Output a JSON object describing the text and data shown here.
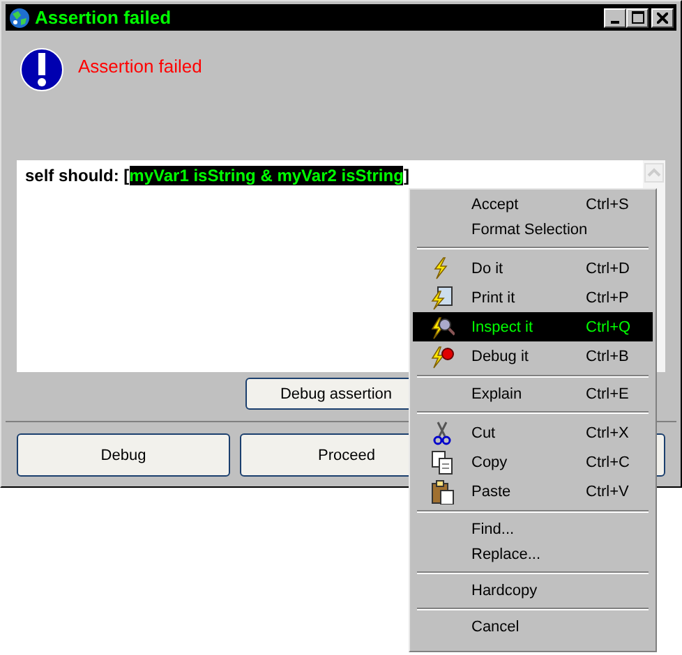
{
  "window": {
    "title": "Assertion failed"
  },
  "message": "Assertion failed",
  "editor": {
    "prefix": "self should: [",
    "selection": "myVar1 isString & myVar2 isString",
    "suffix": "]"
  },
  "action_button": "Debug assertion",
  "buttons": [
    {
      "kind": "labeled",
      "label": "Debug"
    },
    {
      "kind": "labeled",
      "label": "Proceed"
    },
    {
      "kind": "covered"
    }
  ],
  "context_menu": [
    {
      "kind": "plain",
      "label": "Accept",
      "shortcut": "Ctrl+S",
      "selected": false
    },
    {
      "kind": "plain",
      "label": "Format Selection",
      "selected": false
    },
    {
      "kind": "separator"
    },
    {
      "kind": "evaluate",
      "label": "Do it",
      "shortcut": "Ctrl+D",
      "selected": false
    },
    {
      "kind": "print",
      "label": "Print it",
      "shortcut": "Ctrl+P",
      "selected": false
    },
    {
      "kind": "inspect",
      "label": "Inspect it",
      "shortcut": "Ctrl+Q",
      "selected": true
    },
    {
      "kind": "debug",
      "label": "Debug it",
      "shortcut": "Ctrl+B",
      "selected": false
    },
    {
      "kind": "separator"
    },
    {
      "kind": "plain",
      "label": "Explain",
      "shortcut": "Ctrl+E",
      "selected": false
    },
    {
      "kind": "separator"
    },
    {
      "kind": "cut",
      "label": "Cut",
      "shortcut": "Ctrl+X",
      "selected": false
    },
    {
      "kind": "copy",
      "label": "Copy",
      "shortcut": "Ctrl+C",
      "selected": false
    },
    {
      "kind": "paste",
      "label": "Paste",
      "shortcut": "Ctrl+V",
      "selected": false
    },
    {
      "kind": "separator"
    },
    {
      "kind": "plain",
      "label": "Find...",
      "selected": false
    },
    {
      "kind": "plain",
      "label": "Replace...",
      "selected": false
    },
    {
      "kind": "separator"
    },
    {
      "kind": "plain",
      "label": "Hardcopy",
      "selected": false
    },
    {
      "kind": "separator"
    },
    {
      "kind": "plain",
      "label": "Cancel",
      "selected": false
    }
  ]
}
